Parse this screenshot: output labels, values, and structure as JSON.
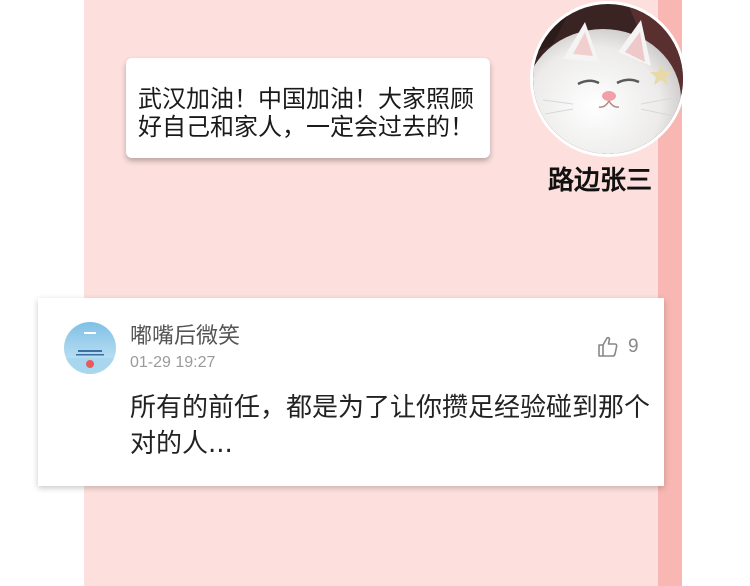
{
  "comic_panel": {
    "speech_bubble_text": "武汉加油！中国加油！大家照顾好自己和家人，一定会过去的！",
    "character_name": "路边张三",
    "background_color": "#fde0de",
    "edge_color": "#f8b7b2"
  },
  "comment": {
    "username": "嘟嘴后微笑",
    "timestamp": "01-29 19:27",
    "like_count": "9",
    "text": "所有的前任，都是为了让你攒足经验碰到那个对的人...",
    "avatar_icon": "user-avatar-image",
    "like_icon": "thumbs-up-icon"
  }
}
